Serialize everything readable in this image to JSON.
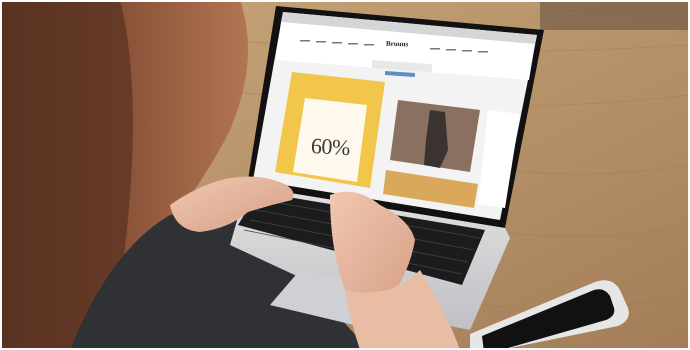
{
  "website": {
    "logo_text": "Bruuns",
    "promo_discount": "60%"
  },
  "colors": {
    "table_wood": "#b8946a",
    "laptop_silver": "#d9d9db",
    "promo_yellow": "#f2c64a",
    "phone_silver": "#e6e6e6"
  }
}
